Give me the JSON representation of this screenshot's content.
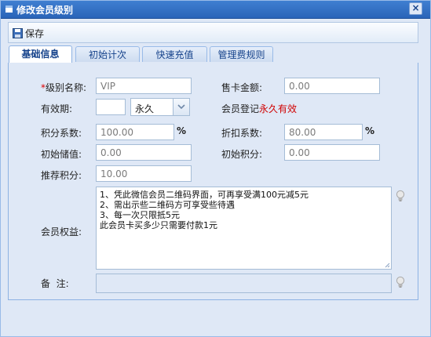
{
  "window": {
    "title": "修改会员级别",
    "close_glyph": "×"
  },
  "toolbar": {
    "save_label": "保存"
  },
  "tabs": [
    {
      "label": "基础信息"
    },
    {
      "label": "初始计次"
    },
    {
      "label": "快速充值"
    },
    {
      "label": "管理费规则"
    }
  ],
  "form": {
    "level_name": {
      "required_mark": "*",
      "label": "级别名称:",
      "value": "VIP"
    },
    "card_price": {
      "label": "售卡金额:",
      "value": "0.00"
    },
    "validity": {
      "label": "有效期:",
      "value": "",
      "unit": "永久"
    },
    "register_note": {
      "prefix": "会员登记",
      "emphasis": "永久有效"
    },
    "points_ratio": {
      "label": "积分系数:",
      "value": "100.00",
      "suffix": "%"
    },
    "discount_ratio": {
      "label": "折扣系数:",
      "value": "80.00",
      "suffix": "%"
    },
    "initial_balance": {
      "label": "初始储值:",
      "value": "0.00"
    },
    "initial_points": {
      "label": "初始积分:",
      "value": "0.00"
    },
    "referral_points": {
      "label": "推荐积分:",
      "value": "10.00"
    },
    "benefits": {
      "label": "会员权益:",
      "lines": [
        "1、凭此微信会员二维码界面，可再享受满100元减5元",
        "2、需出示些二维码方可享受些待遇",
        "3、每一次只限抵5元",
        "此会员卡买多少只需要付款1元"
      ]
    },
    "remark": {
      "label": "备  注:",
      "value": ""
    }
  },
  "colors": {
    "accent": "#15428b",
    "title_bar": "#2a64b8",
    "highlight": "#d00000"
  },
  "icons": [
    "window-icon",
    "close-icon",
    "save-icon",
    "chevron-down-icon",
    "lightbulb-icon"
  ]
}
